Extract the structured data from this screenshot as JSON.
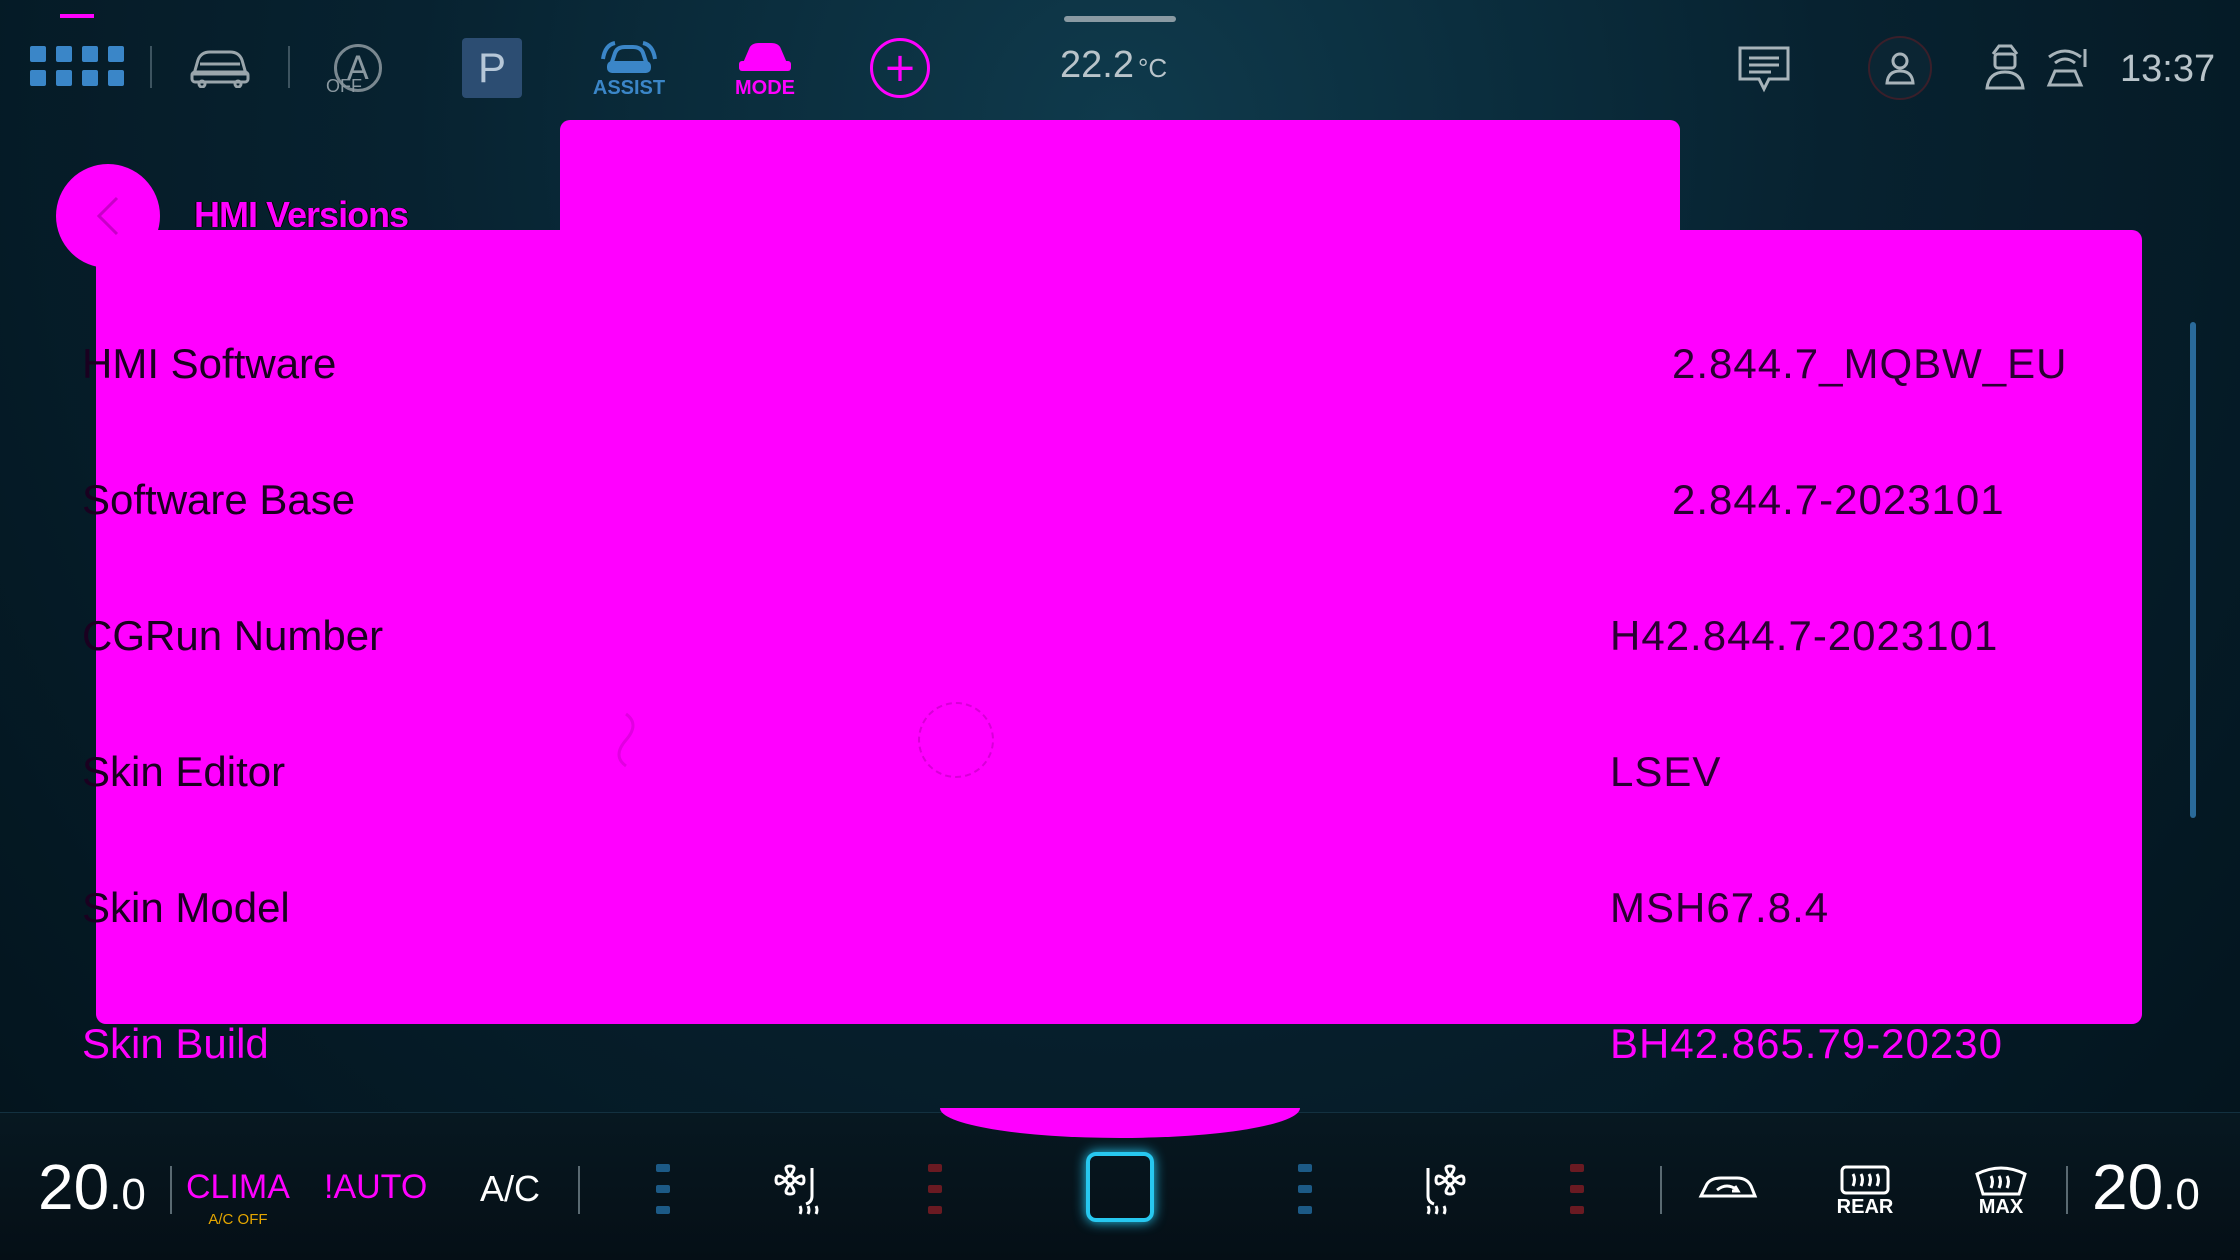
{
  "status_bar": {
    "auto_off_letter": "A",
    "auto_off_label": "OFF",
    "parking_label": "P",
    "assist_label": "ASSIST",
    "mode_label": "MODE",
    "plus_label": "+",
    "outside_temp": "22.2",
    "outside_temp_unit": "°C",
    "clock": "13:37"
  },
  "page": {
    "title": "HMI Versions",
    "rows": [
      {
        "label": "HMI Software",
        "value": "2.844.7_MQBW_EU"
      },
      {
        "label": "Software Base",
        "value": "2.844.7-2023101"
      },
      {
        "label": "CGRun Number",
        "value": "H42.844.7-2023101"
      },
      {
        "label": "Skin Editor",
        "value": "LSEV"
      },
      {
        "label": "Skin Model",
        "value": "MSH67.8.4"
      },
      {
        "label": "Skin Build",
        "value": "BH42.865.79-20230"
      }
    ]
  },
  "climate_bar": {
    "left_temp": "20",
    "left_temp_dec": ".0",
    "clima_label": "CLIMA",
    "ac_off_label": "A/C OFF",
    "auto_label": "!AUTO",
    "ac_label": "A/C",
    "rear_label": "REAR",
    "max_label": "MAX",
    "right_temp": "20",
    "right_temp_dec": ".0"
  },
  "colors": {
    "accent": "#ff00ff",
    "highlight": "#27c8f0",
    "background": "#072230",
    "warning": "#e5a600"
  },
  "icons": [
    "apps-grid-icon",
    "car-icon",
    "auto-off-icon",
    "parking-icon",
    "assist-icon",
    "mode-icon",
    "plus-icon",
    "message-icon",
    "profile-icon",
    "driver-icon",
    "signal-icon",
    "back-arrow-icon",
    "fan-icon",
    "seat-fan-icon",
    "recirculation-icon",
    "rear-defrost-icon",
    "max-defrost-icon"
  ]
}
